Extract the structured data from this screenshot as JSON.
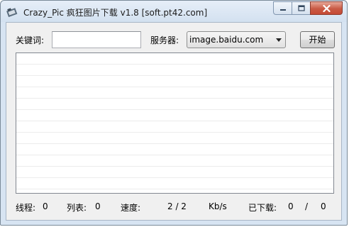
{
  "window": {
    "title": "Crazy_Pic 疯狂图片下载 v1.8 [soft.pt42.com]",
    "icons": {
      "app": "app-icon",
      "minimize": "minimize-icon",
      "maximize": "maximize-icon",
      "close": "close-icon"
    }
  },
  "search": {
    "keyword_label": "关键词:",
    "keyword_value": "",
    "server_label": "服务器:",
    "server_selected": "image.baidu.com",
    "start_label": "开始"
  },
  "results": {
    "rows": []
  },
  "status": {
    "threads_label": "线程:",
    "threads_value": "0",
    "list_label": "列表:",
    "list_value": "0",
    "speed_label": "速度:",
    "speed_value": "2 / 2",
    "speed_unit": "Kb/s",
    "downloaded_label": "已下载:",
    "downloaded_value": "0",
    "downloaded_sep": "/",
    "downloaded_total": "0"
  },
  "colors": {
    "window_frame": "#d7e4f2",
    "client_bg": "#f0f0f0",
    "close_button": "#c64a35"
  }
}
